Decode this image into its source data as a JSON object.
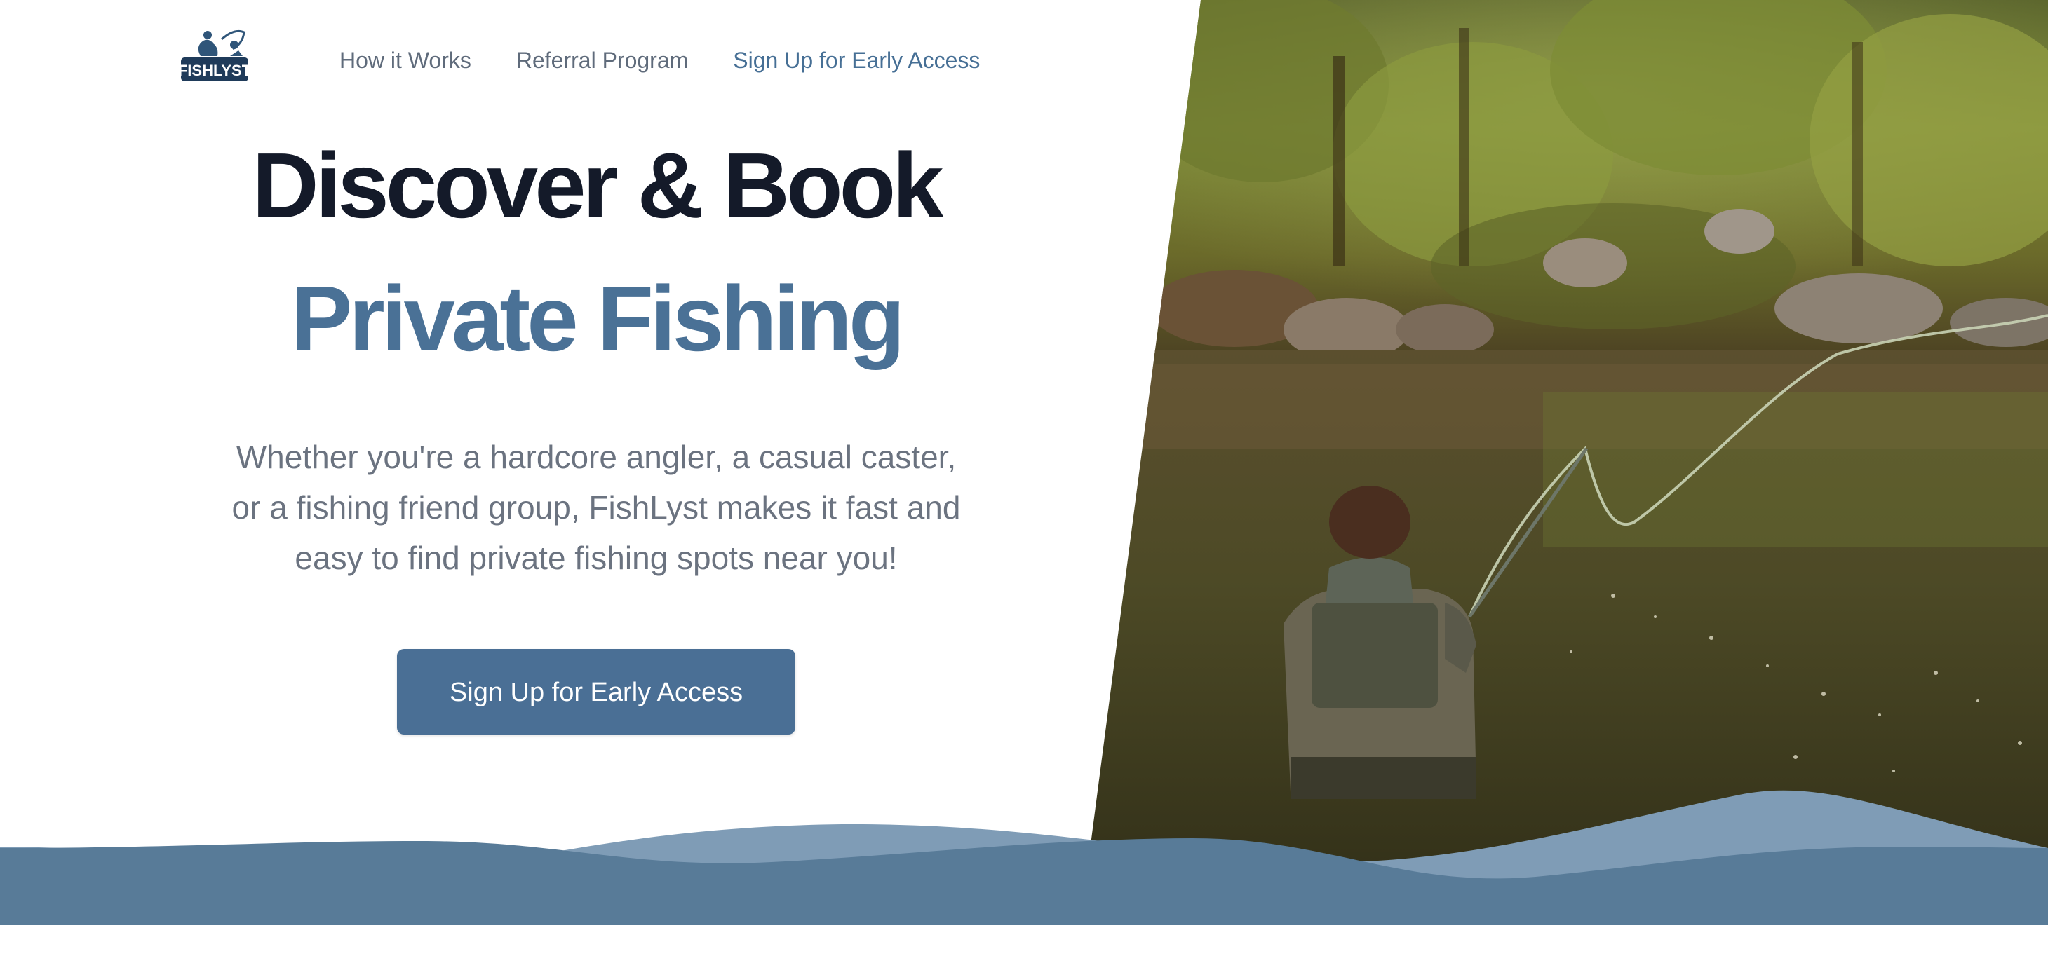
{
  "brand": {
    "name": "FISHLYST",
    "logo_icon": "fisherman-icon"
  },
  "nav": {
    "items": [
      {
        "label": "How it Works"
      },
      {
        "label": "Referral Program"
      },
      {
        "label": "Sign Up for Early Access"
      }
    ]
  },
  "hero": {
    "headline_line1": "Discover & Book",
    "headline_line2": "Private Fishing",
    "subtitle": "Whether you're a hardcore angler, a casual caster, or a fishing friend group, FishLyst makes it fast and easy to find private fishing spots near you!",
    "cta_label": "Sign Up for Early Access",
    "image_subject": "angler-fly-fishing-in-river"
  },
  "colors": {
    "primary": "#4a6f95",
    "heading_dark": "#141a29",
    "body_text": "#6b7380",
    "nav_text": "#5f6b7b",
    "wave_light": "#7f9cb6",
    "wave_dark": "#587b98"
  }
}
